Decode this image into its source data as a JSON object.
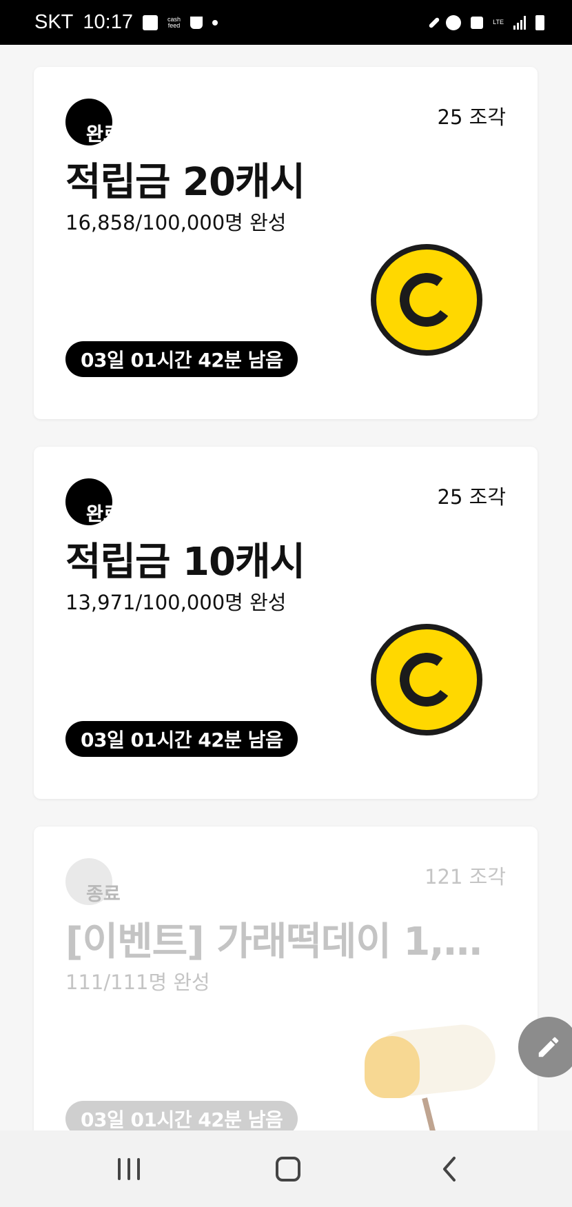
{
  "status_bar": {
    "carrier": "SKT",
    "time": "10:17",
    "network": "LTE"
  },
  "cards": [
    {
      "status": "완료",
      "pieces": "25 조각",
      "title": "적립금 20캐시",
      "progress": "16,858/100,000명 완성",
      "time_left": "03일 01시간 42분 남음",
      "image": "coin-icon"
    },
    {
      "status": "완료",
      "pieces": "25 조각",
      "title": "적립금 10캐시",
      "progress": "13,971/100,000명 완성",
      "time_left": "03일 01시간 42분 남음",
      "image": "coin-icon"
    },
    {
      "status": "종료",
      "pieces": "121 조각",
      "title": "[이벤트] 가래떡데이 1,1…",
      "progress": "111/111명 완성",
      "time_left": "03일 01시간 42분 남음",
      "image": "rice-cake-image"
    }
  ],
  "fab": {
    "icon": "pencil-icon"
  },
  "nav_bar": {
    "recent_icon": "recent-apps-icon",
    "home_icon": "home-icon",
    "back_icon": "back-icon"
  },
  "colors": {
    "coin_yellow": "#ffd800",
    "badge_black": "#000000",
    "ended_gray": "#c4c4c4",
    "fab_gray": "#8c8c8c"
  }
}
